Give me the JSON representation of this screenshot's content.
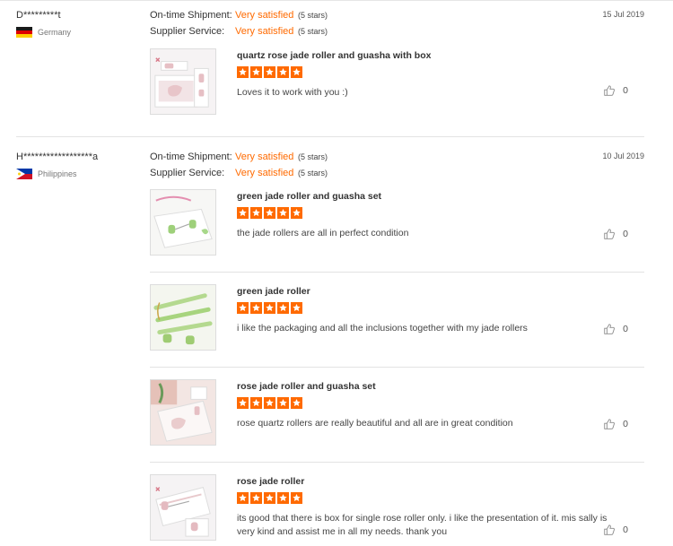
{
  "colors": {
    "accent": "#ff6a00",
    "divider": "#e3e3e3"
  },
  "labels": {
    "shipment": "On-time Shipment:",
    "service": "Supplier Service:"
  },
  "reviews": [
    {
      "buyer": "D*********t",
      "country": "Germany",
      "flag_icon": "flag-germany-icon",
      "shipment_value": "Very satisfied",
      "shipment_stars": "(5 stars)",
      "service_value": "Very satisfied",
      "service_stars": "(5 stars)",
      "date": "15 Jul 2019",
      "products": [
        {
          "title": "quartz rose jade roller and guasha with box",
          "rating": 5,
          "comment": "Loves it to work with you :)",
          "likes": "0"
        }
      ]
    },
    {
      "buyer": "H******************a",
      "country": "Philippines",
      "flag_icon": "flag-philippines-icon",
      "shipment_value": "Very satisfied",
      "shipment_stars": "(5 stars)",
      "service_value": "Very satisfied",
      "service_stars": "(5 stars)",
      "date": "10 Jul 2019",
      "products": [
        {
          "title": "green jade roller and guasha set",
          "rating": 5,
          "comment": "the jade rollers are all in perfect condition",
          "likes": "0"
        },
        {
          "title": "green jade roller",
          "rating": 5,
          "comment": "i like the packaging and all the inclusions together with my jade rollers",
          "likes": "0"
        },
        {
          "title": "rose jade roller and guasha set",
          "rating": 5,
          "comment": "rose quartz rollers are really beautiful and all are in great condition",
          "likes": "0"
        },
        {
          "title": "rose jade roller",
          "rating": 5,
          "comment": "its good that there is box for single rose roller only. i like the presentation of it. mis sally is very kind and assist me in all my needs. thank you",
          "likes": "0"
        }
      ]
    }
  ]
}
